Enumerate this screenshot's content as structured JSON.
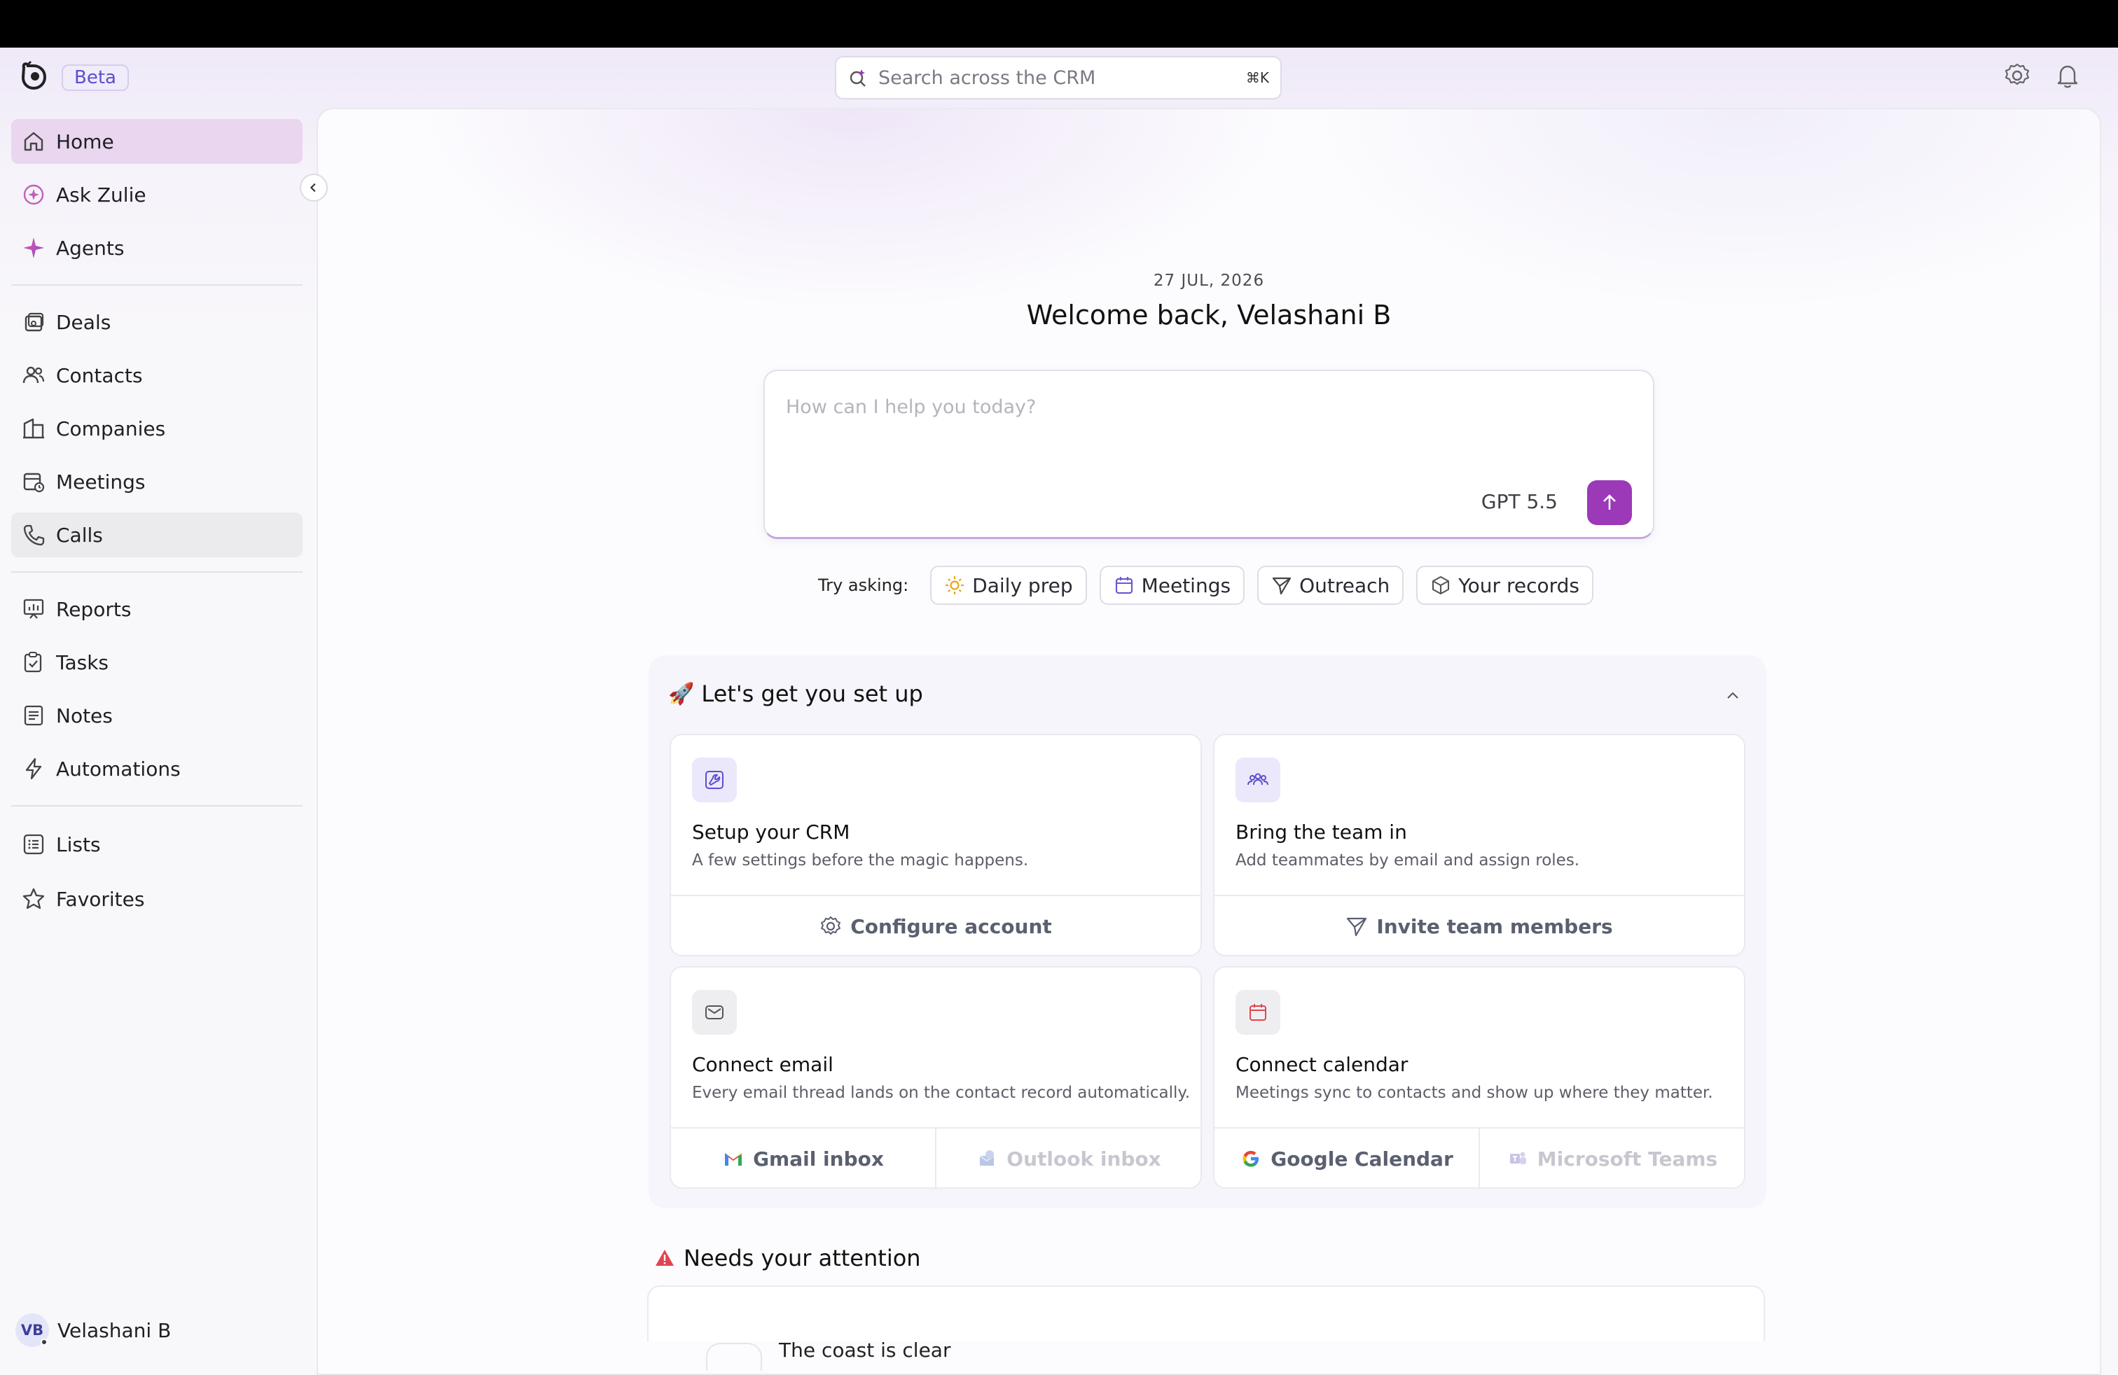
{
  "header": {
    "beta_label": "Beta",
    "search_placeholder": "Search across the CRM",
    "search_shortcut": "⌘K"
  },
  "sidebar": {
    "items": [
      {
        "label": "Home",
        "icon": "home-icon"
      },
      {
        "label": "Ask Zulie",
        "icon": "ask-zulie-icon"
      },
      {
        "label": "Agents",
        "icon": "sparkle-icon"
      },
      {
        "label": "Deals",
        "icon": "deals-icon"
      },
      {
        "label": "Contacts",
        "icon": "contacts-icon"
      },
      {
        "label": "Companies",
        "icon": "building-icon"
      },
      {
        "label": "Meetings",
        "icon": "calendar-clock-icon"
      },
      {
        "label": "Calls",
        "icon": "phone-icon"
      },
      {
        "label": "Reports",
        "icon": "chart-icon"
      },
      {
        "label": "Tasks",
        "icon": "task-icon"
      },
      {
        "label": "Notes",
        "icon": "note-icon"
      },
      {
        "label": "Automations",
        "icon": "bolt-icon"
      },
      {
        "label": "Lists",
        "icon": "list-icon"
      },
      {
        "label": "Favorites",
        "icon": "star-icon"
      }
    ],
    "user": {
      "initials": "VB",
      "name": "Velashani B"
    }
  },
  "main": {
    "date": "27 JUL, 2026",
    "welcome": "Welcome back, Velashani B",
    "prompt_placeholder": "How can I help you today?",
    "model": "GPT 5.5",
    "try_label": "Try asking:",
    "chips": [
      "Daily prep",
      "Meetings",
      "Outreach",
      "Your records"
    ]
  },
  "setup": {
    "title": "Let's get you set up",
    "cards": [
      {
        "title": "Setup your CRM",
        "desc": "A few settings before the magic happens.",
        "actions": [
          "Configure account"
        ]
      },
      {
        "title": "Bring the team in",
        "desc": "Add teammates by email and assign roles.",
        "actions": [
          "Invite team members"
        ]
      },
      {
        "title": "Connect email",
        "desc": "Every email thread lands on the contact record automatically.",
        "actions": [
          "Gmail inbox",
          "Outlook inbox"
        ]
      },
      {
        "title": "Connect calendar",
        "desc": "Meetings sync to contacts and show up where they matter.",
        "actions": [
          "Google Calendar",
          "Microsoft Teams"
        ]
      }
    ]
  },
  "attention": {
    "title": "Needs your attention",
    "empty_text": "The coast is clear"
  },
  "colors": {
    "accent": "#9b39b8",
    "active_nav": "#ead6ef",
    "warning": "#e0454f"
  }
}
